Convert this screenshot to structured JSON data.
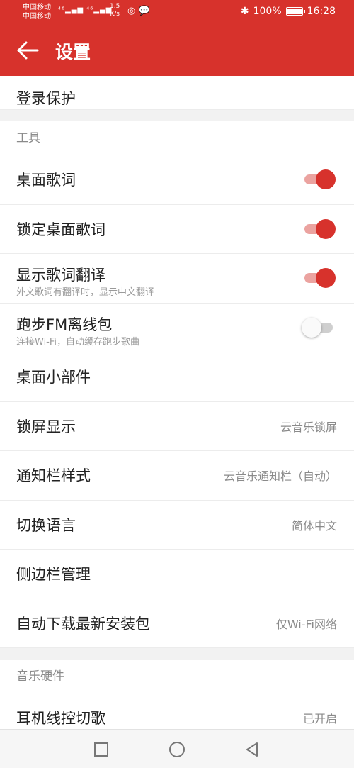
{
  "statusbar": {
    "carrier1": "中国移动",
    "carrier2": "中国移动",
    "signal": "⁴⁶▂▄▆ ⁴⁶▂▄▆",
    "speed_value": "1.5",
    "speed_unit": "K/s",
    "icons": "◎ 💬",
    "bluetooth": "✱",
    "battery_text": "100%",
    "time": "16:28"
  },
  "header": {
    "title": "设置"
  },
  "settings": {
    "login_protect": "登录保护",
    "tools_section": "工具",
    "desktop_lyrics": "桌面歌词",
    "desktop_lyrics_on": true,
    "lock_desktop_lyrics": "锁定桌面歌词",
    "lock_desktop_lyrics_on": true,
    "show_translation": "显示歌词翻译",
    "show_translation_sub": "外文歌词有翻译时，显示中文翻译",
    "show_translation_on": true,
    "running_fm": "跑步FM离线包",
    "running_fm_sub": "连接Wi-Fi，自动缓存跑步歌曲",
    "running_fm_on": false,
    "desktop_widget": "桌面小部件",
    "lock_screen": "锁屏显示",
    "lock_screen_value": "云音乐锁屏",
    "notification_style": "通知栏样式",
    "notification_style_value": "云音乐通知栏（自动）",
    "language": "切换语言",
    "language_value": "简体中文",
    "sidebar_manage": "侧边栏管理",
    "auto_download": "自动下载最新安装包",
    "auto_download_value": "仅Wi-Fi网络",
    "hardware_section": "音乐硬件",
    "headset_control": "耳机线控切歌",
    "headset_control_value": "已开启"
  },
  "colors": {
    "accent": "#d7322c",
    "track_on": "#eba3a0",
    "track_off": "#cfcfcf"
  },
  "navbar": {
    "icons": [
      "square-icon",
      "circle-icon",
      "triangle-back-icon"
    ]
  }
}
